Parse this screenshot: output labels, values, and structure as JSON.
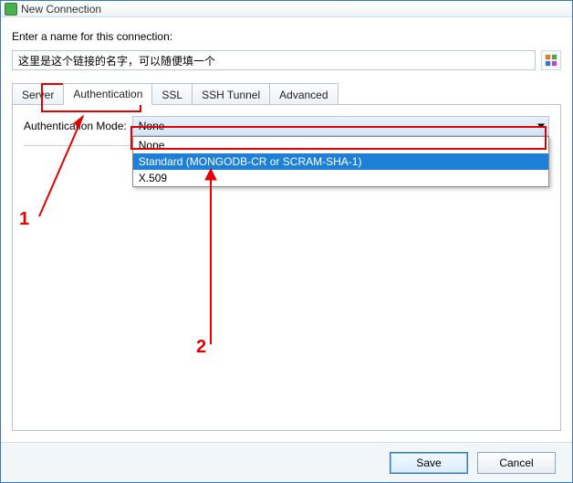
{
  "window_title": "New Connection",
  "name_prompt": "Enter a name for this connection:",
  "name_value": "这里是这个链接的名字，可以随便填一个",
  "tabs": {
    "server": "Server",
    "authentication": "Authentication",
    "ssl": "SSL",
    "ssh_tunnel": "SSH Tunnel",
    "advanced": "Advanced",
    "active": "authentication"
  },
  "auth": {
    "mode_label": "Authentication Mode:",
    "selected": "None",
    "options": {
      "none": "None",
      "standard": "Standard (MONGODB-CR or SCRAM-SHA-1)",
      "x509": "X.509"
    },
    "highlighted": "standard"
  },
  "annotations": {
    "num1": "1",
    "num2": "2"
  },
  "footer": {
    "save": "Save",
    "cancel": "Cancel"
  },
  "icons": {
    "app": "app-icon",
    "connection_icon": "connection-props-icon",
    "chevron_down": "chevron-down-icon"
  }
}
